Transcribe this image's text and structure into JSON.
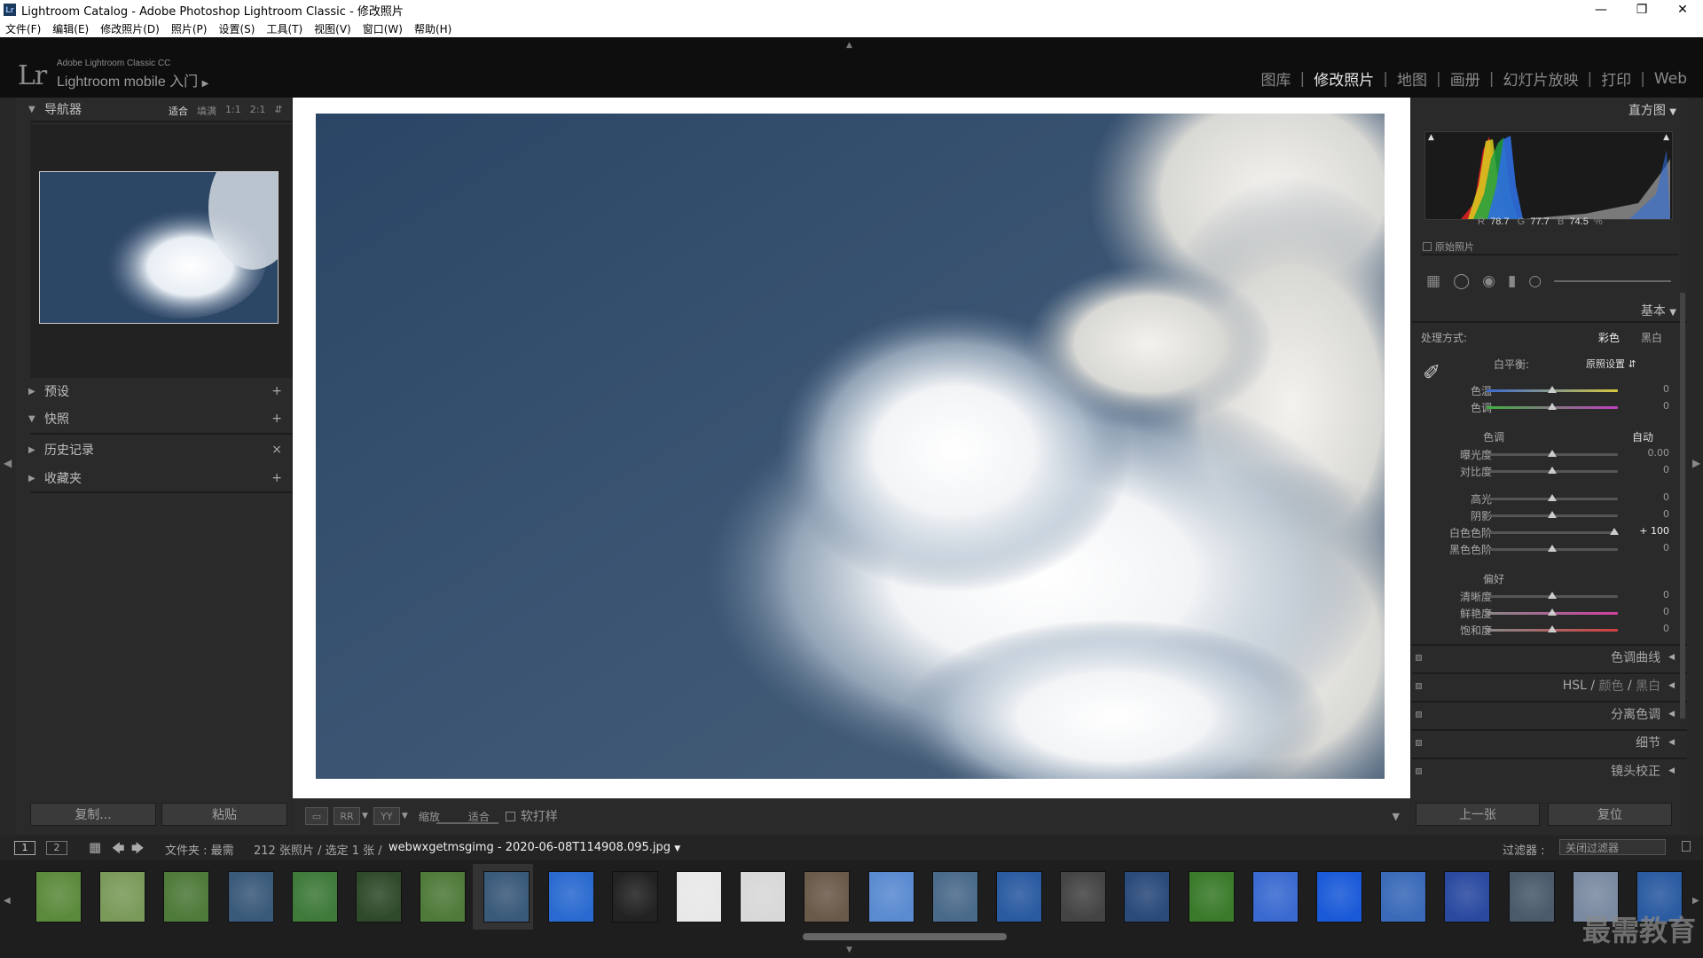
{
  "window": {
    "title": "Lightroom Catalog - Adobe Photoshop Lightroom Classic - 修改照片",
    "app_icon": "Lr"
  },
  "menu": [
    "文件(F)",
    "编辑(E)",
    "修改照片(D)",
    "照片(P)",
    "设置(S)",
    "工具(T)",
    "视图(V)",
    "窗口(W)",
    "帮助(H)"
  ],
  "identity": {
    "logo": "Lr",
    "sub": "Adobe Lightroom Classic CC",
    "main": "Lightroom mobile 入门"
  },
  "modules": [
    "图库",
    "修改照片",
    "地图",
    "画册",
    "幻灯片放映",
    "打印",
    "Web"
  ],
  "active_module": "修改照片",
  "left": {
    "navigator": {
      "title": "导航器",
      "options": [
        "适合",
        "填满",
        "1:1",
        "2:1"
      ],
      "active": "适合"
    },
    "panels": [
      {
        "title": "预设",
        "icon": "plus-icon",
        "sym": "+"
      },
      {
        "title": "快照",
        "icon": "plus-icon",
        "sym": "+"
      },
      {
        "title": "历史记录",
        "icon": "close-icon",
        "sym": "×"
      },
      {
        "title": "收藏夹",
        "icon": "plus-icon",
        "sym": "+"
      }
    ],
    "copy_button": "复制...",
    "paste_button": "粘贴"
  },
  "toolbar": {
    "zoom_label": "缩放",
    "fit_label": "适合",
    "softproof_label": "软打样"
  },
  "right": {
    "histogram_title": "直方图",
    "rgb": {
      "r_label": "R",
      "r": "78.7",
      "g_label": "G",
      "g": "77.7",
      "b_label": "B",
      "b": "74.5",
      "unit": "%"
    },
    "original_label": "原始照片",
    "basic_title": "基本",
    "treatment_label": "处理方式:",
    "color_label": "彩色",
    "bw_label": "黑白",
    "wb_label": "白平衡:",
    "wb_value": "原照设置",
    "temp": {
      "label": "色温",
      "value": "0",
      "pos": 0.5
    },
    "tint": {
      "label": "色调",
      "value": "0",
      "pos": 0.5
    },
    "tone_title": "色调",
    "auto_label": "自动",
    "exposure": {
      "label": "曝光度",
      "value": "0.00",
      "pos": 0.5
    },
    "contrast": {
      "label": "对比度",
      "value": "0",
      "pos": 0.5
    },
    "highlights": {
      "label": "高光",
      "value": "0",
      "pos": 0.5
    },
    "shadows": {
      "label": "阴影",
      "value": "0",
      "pos": 0.5
    },
    "whites": {
      "label": "白色色阶",
      "value": "+ 100",
      "pos": 0.97
    },
    "blacks": {
      "label": "黑色色阶",
      "value": "0",
      "pos": 0.5
    },
    "presence_title": "偏好",
    "clarity": {
      "label": "清晰度",
      "value": "0",
      "pos": 0.5
    },
    "vibrance": {
      "label": "鲜艳度",
      "value": "0",
      "pos": 0.5
    },
    "saturation": {
      "label": "饱和度",
      "value": "0",
      "pos": 0.5
    },
    "sections": [
      "色调曲线",
      "细节",
      "镜头校正"
    ],
    "hsl": {
      "a": "HSL",
      "b": "颜色",
      "c": "黑白"
    },
    "split": "分离色调",
    "prev_button": "上一张",
    "reset_button": "复位"
  },
  "filmbar": {
    "pages": [
      "1",
      "2"
    ],
    "folder": "文件夹 : 最需",
    "count": "212 张照片 / 选定 1 张 /",
    "filename": "webwxgetmsgimg - 2020-06-08T114908.095.jpg",
    "filter_label": "过滤器 :",
    "filter_value": "关闭过滤器"
  },
  "watermark": "最需教育",
  "thumbs": [
    "#5b8a3c",
    "#7a9a5a",
    "#4e7a3a",
    "#3a5a7a",
    "#3f7a3a",
    "#2f4a2a",
    "#4f7a3a",
    "#3a5a7a",
    "#2a6ad0",
    "#222222",
    "#e8e8e8",
    "#d8d8d8",
    "#6a5a4a",
    "#5a8ad0",
    "#4a6a8a",
    "#2a5aa0",
    "#444444",
    "#2a4a7a",
    "#3a7a2a",
    "#3a6ad0",
    "#1a5ad8",
    "#3a6ab8",
    "#2a4aa0",
    "#4a5a6a",
    "#7a8aa0",
    "#2a5aa0"
  ]
}
